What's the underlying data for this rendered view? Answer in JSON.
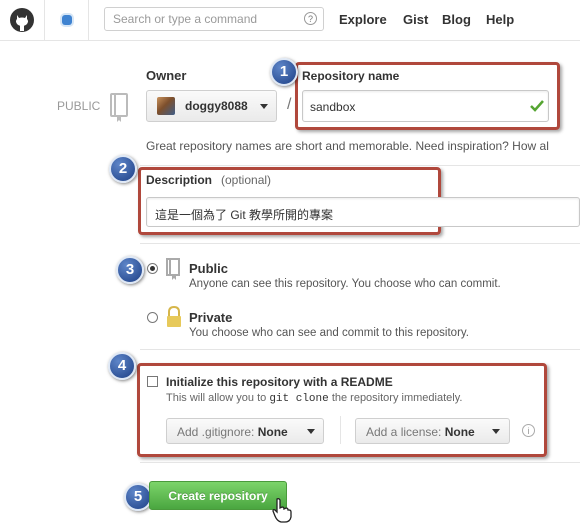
{
  "header": {
    "search_placeholder": "Search or type a command",
    "search_help": "?",
    "nav": [
      "Explore",
      "Gist",
      "Blog",
      "Help"
    ]
  },
  "owner": {
    "label": "Owner",
    "name": "doggy8088"
  },
  "visibility_tag": "PUBLIC",
  "repo": {
    "label": "Repository name",
    "separator": "/",
    "value": "sandbox",
    "hint": "Great repository names are short and memorable. Need inspiration? How al"
  },
  "description": {
    "label": "Description",
    "optional": "(optional)",
    "value": "這是一個為了 Git 教學所開的專案"
  },
  "visibility": {
    "public_label": "Public",
    "public_desc": "Anyone can see this repository. You choose who can commit.",
    "private_label": "Private",
    "private_desc": "You choose who can see and commit to this repository."
  },
  "init": {
    "label": "Initialize this repository with a README",
    "desc_prefix": "This will allow you to",
    "desc_code": "git clone",
    "desc_suffix": "the repository immediately.",
    "gitignore_prefix": "Add .gitignore:",
    "gitignore_value": "None",
    "license_prefix": "Add a license:",
    "license_value": "None",
    "info": "i"
  },
  "steps": [
    "1",
    "2",
    "3",
    "4",
    "5"
  ],
  "create_button": "Create repository",
  "colors": {
    "highlight": "#b0483c",
    "step_badge": "#2b4e94",
    "create_green": "#55b048",
    "check_green": "#55a532"
  }
}
